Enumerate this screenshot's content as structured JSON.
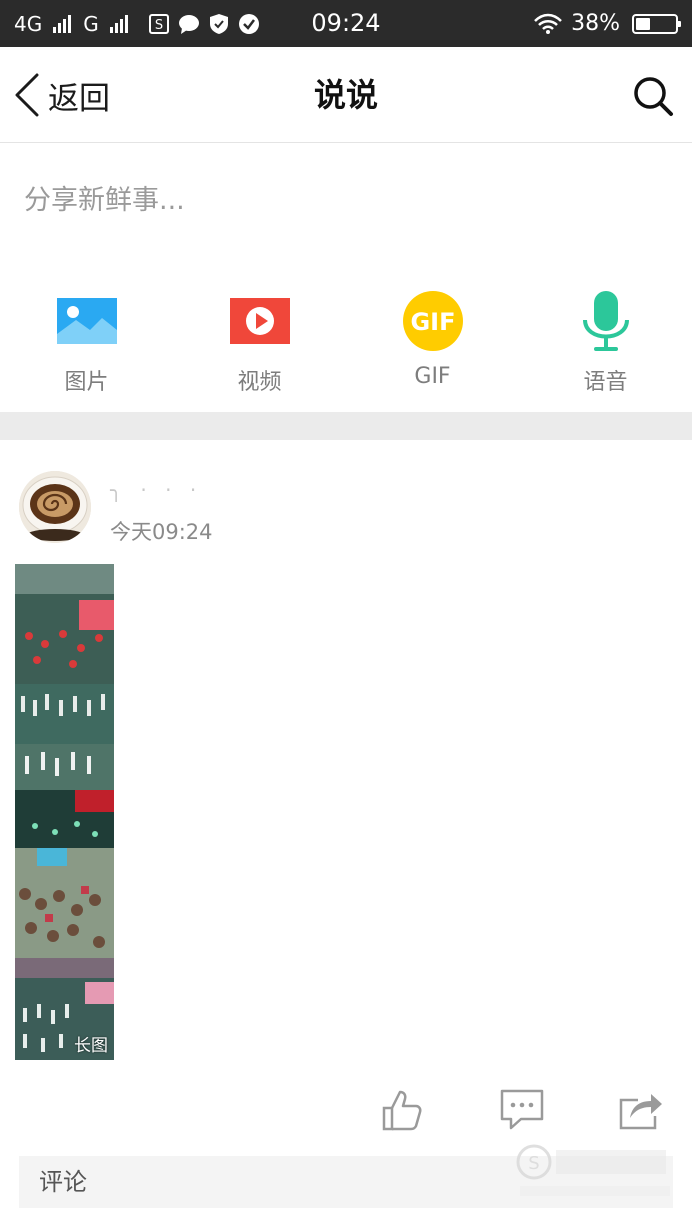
{
  "status_bar": {
    "network_1": "4G",
    "network_2": "G",
    "time": "09:24",
    "battery_text": "38%",
    "battery_level": 0.38,
    "icons": [
      "signal-icon",
      "sim-s-icon",
      "message-bubble-icon",
      "shield-icon",
      "check-circle-icon",
      "wifi-icon",
      "battery-icon"
    ]
  },
  "nav": {
    "back_label": "返回",
    "title": "说说",
    "search_icon": "search-icon"
  },
  "compose": {
    "placeholder": "分享新鲜事...",
    "tools": [
      {
        "label": "图片",
        "icon": "image-icon",
        "color": "#2aa9f2"
      },
      {
        "label": "视频",
        "icon": "video-play-icon",
        "color": "#f0473a"
      },
      {
        "label": "GIF",
        "icon": "gif-icon",
        "color": "#ffcc00"
      },
      {
        "label": "语音",
        "icon": "microphone-icon",
        "color": "#2cc79a"
      }
    ]
  },
  "post": {
    "user_name": "╮ · · ·",
    "time": "今天09:24",
    "image_badge": "长图",
    "actions": [
      "like-icon",
      "comment-icon",
      "share-icon"
    ]
  },
  "comment": {
    "label": "评论"
  },
  "colors": {
    "status_bar_bg": "#2b2b2b",
    "divider_band": "#ebebeb",
    "comment_bar_bg": "#f4f4f4"
  }
}
